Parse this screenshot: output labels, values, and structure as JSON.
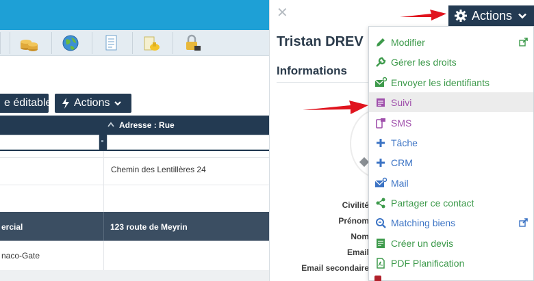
{
  "left": {
    "toolbar": {
      "editable_label": "e éditable",
      "actions_label": "Actions"
    },
    "table": {
      "address_header": "Adresse : Rue",
      "rows": [
        {
          "address": "Chemin des Lentillères 24"
        }
      ],
      "group_row": {
        "left": "ercial",
        "right": "123 route de Meyrin"
      },
      "after_group": {
        "left": "naco-Gate"
      }
    },
    "iconbar_icons": [
      "coins-icon",
      "globe-icon",
      "document-icon",
      "folder-key-icon",
      "padlock-icon"
    ]
  },
  "panel": {
    "close_glyph": "✕",
    "contact_name": "Tristan DREV",
    "info_title": "Informations",
    "field_labels": [
      "Civilité",
      "Prénom",
      "Nom",
      "Email",
      "Email secondaire"
    ]
  },
  "actions_button": {
    "label": "Actions"
  },
  "menu": {
    "items": [
      {
        "label": "Modifier",
        "color": "#3d9a4b",
        "icon": "pencil-icon",
        "external": true
      },
      {
        "label": "Gérer les droits",
        "color": "#3d9a4b",
        "icon": "wrench-icon",
        "external": false
      },
      {
        "label": "Envoyer les identifiants",
        "color": "#3d9a4b",
        "icon": "envelope-icon",
        "external": false
      },
      {
        "label": "Suivi",
        "color": "#9f4fab",
        "icon": "note-icon",
        "external": false
      },
      {
        "label": "SMS",
        "color": "#9f4fab",
        "icon": "phone-icon",
        "external": false
      },
      {
        "label": "Tâche",
        "color": "#3b73c4",
        "icon": "plus-icon",
        "external": false
      },
      {
        "label": "CRM",
        "color": "#3b73c4",
        "icon": "plus-icon",
        "external": false
      },
      {
        "label": "Mail",
        "color": "#3b73c4",
        "icon": "mail-icon",
        "external": false
      },
      {
        "label": "Partager ce contact",
        "color": "#3d9a4b",
        "icon": "share-icon",
        "external": false
      },
      {
        "label": "Matching biens",
        "color": "#3b73c4",
        "icon": "match-icon",
        "external": true
      },
      {
        "label": "Créer un devis",
        "color": "#3d9a4b",
        "icon": "quote-icon",
        "external": false
      },
      {
        "label": "PDF Planification",
        "color": "#3d9a4b",
        "icon": "pdf-icon",
        "external": false
      }
    ]
  },
  "colors": {
    "navy": "#233a52",
    "accent_blue": "#1ea0d6",
    "arrow_red": "#e0141e"
  }
}
